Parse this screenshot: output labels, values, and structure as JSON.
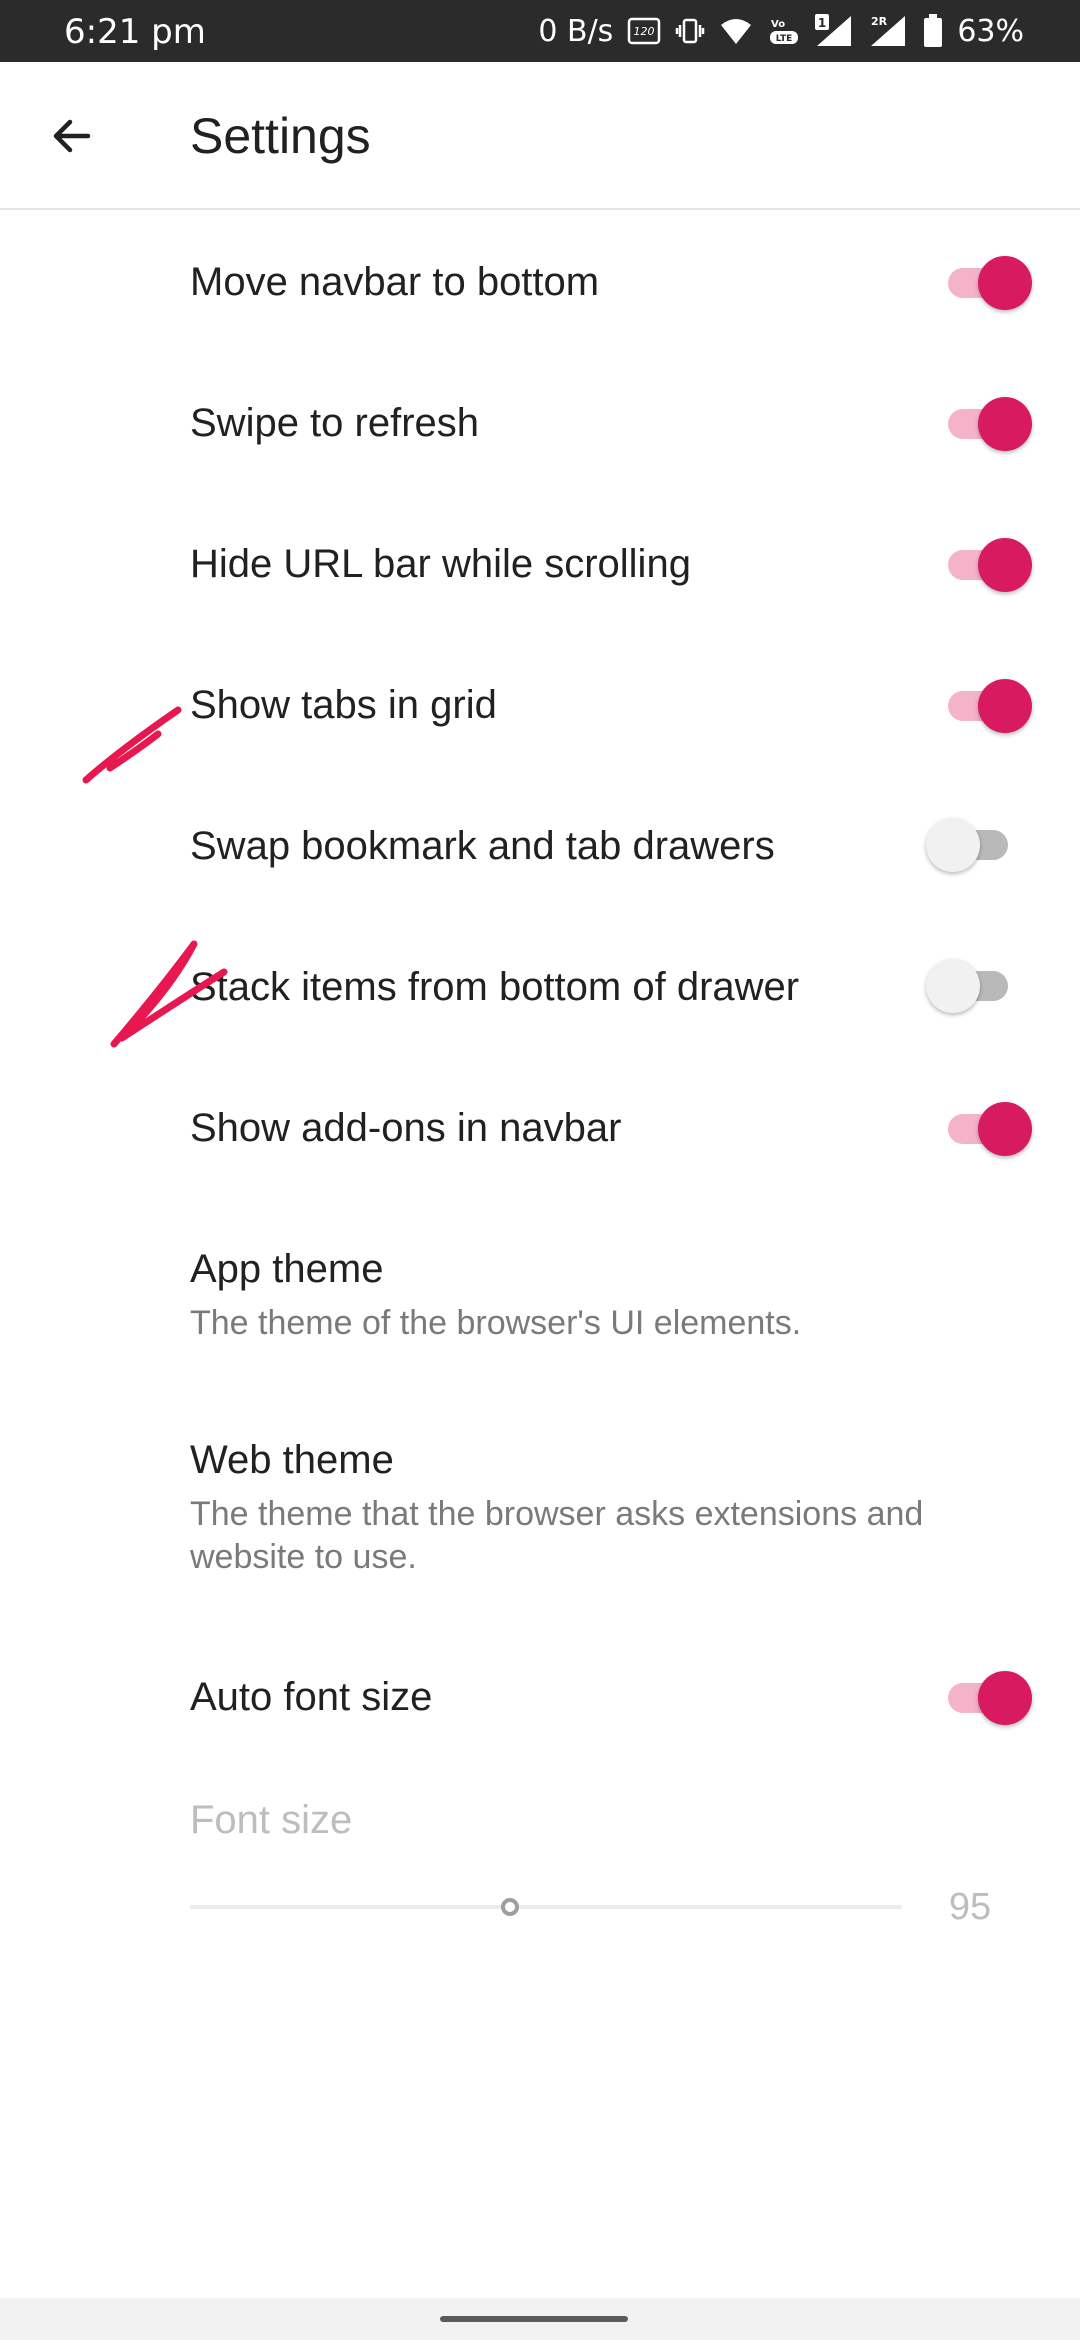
{
  "status_bar": {
    "time": "6:21 pm",
    "network_speed": "0 B/s",
    "refresh_badge": "120",
    "sim1_badge": "1",
    "sim2_badge": "2R",
    "battery": "63%",
    "icons": [
      "refresh-rate-icon",
      "vibrate-icon",
      "wifi-icon",
      "volte-icon",
      "signal-icon",
      "signal-icon",
      "battery-icon"
    ]
  },
  "app_bar": {
    "back_icon": "arrow-back-icon",
    "title": "Settings"
  },
  "settings": [
    {
      "label": "Move navbar to bottom",
      "type": "switch",
      "checked": true
    },
    {
      "label": "Swipe to refresh",
      "type": "switch",
      "checked": true
    },
    {
      "label": "Hide URL bar while scrolling",
      "type": "switch",
      "checked": true
    },
    {
      "label": "Show tabs in grid",
      "type": "switch",
      "checked": true
    },
    {
      "label": "Swap bookmark and tab drawers",
      "type": "switch",
      "checked": false
    },
    {
      "label": "Stack items from bottom of drawer",
      "type": "switch",
      "checked": false
    },
    {
      "label": "Show add-ons in navbar",
      "type": "switch",
      "checked": true
    },
    {
      "label": "App theme",
      "type": "preference",
      "summary": "The theme of the browser's UI elements."
    },
    {
      "label": "Web theme",
      "type": "preference",
      "summary": "The theme that the browser asks extensions and website to use."
    },
    {
      "label": "Auto font size",
      "type": "switch",
      "checked": true
    }
  ],
  "font_size": {
    "label": "Font size",
    "value": "95",
    "slider_fraction": 0.45,
    "enabled": false
  },
  "colors": {
    "accent": "#d81b60",
    "accent_track": "#f4b3c9",
    "annotation": "#e8174f",
    "status_bar_bg": "#2b2b2b"
  }
}
